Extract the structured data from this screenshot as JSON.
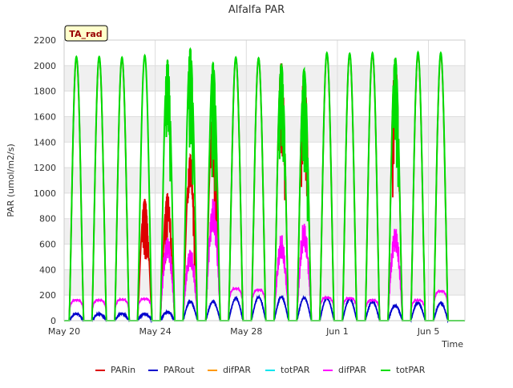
{
  "chart_data": {
    "type": "line",
    "title": "Alfalfa PAR",
    "xlabel": "Time",
    "ylabel": "PAR (umol/m2/s)",
    "station_badge": "TA_rad",
    "ylim": [
      0,
      2200
    ],
    "yticks": [
      0,
      200,
      400,
      600,
      800,
      1000,
      1200,
      1400,
      1600,
      1800,
      2000,
      2200
    ],
    "x_range_days": [
      0,
      17.6
    ],
    "xticks": [
      {
        "label": "May 20",
        "day": 0
      },
      {
        "label": "May 24",
        "day": 4
      },
      {
        "label": "May 28",
        "day": 8
      },
      {
        "label": "Jun 1",
        "day": 12
      },
      {
        "label": "Jun 5",
        "day": 16
      }
    ],
    "grid": true,
    "banded_background": true,
    "legend_position": "bottom",
    "colors": {
      "PARin": "#dd0000",
      "PARout": "#0000cc",
      "difPAR_a": "#ff9900",
      "totPAR_a": "#00e5ee",
      "difPAR_b": "#ff00ff",
      "totPAR_b": "#00dd00"
    },
    "legend": [
      {
        "label": "PARin",
        "color": "#dd0000"
      },
      {
        "label": "PARout",
        "color": "#0000cc"
      },
      {
        "label": "difPAR",
        "color": "#ff9900"
      },
      {
        "label": "totPAR",
        "color": "#00e5ee"
      },
      {
        "label": "difPAR",
        "color": "#ff00ff"
      },
      {
        "label": "totPAR",
        "color": "#00dd00"
      }
    ],
    "days": [
      {
        "day": 0,
        "tot": 2070,
        "parin": 2060,
        "parout": 55,
        "dif": 160,
        "note": "clear"
      },
      {
        "day": 1,
        "tot": 2070,
        "parin": 2060,
        "parout": 55,
        "dif": 160,
        "note": "clear"
      },
      {
        "day": 2,
        "tot": 2065,
        "parin": 2055,
        "parout": 55,
        "dif": 165,
        "note": "clear"
      },
      {
        "day": 3,
        "tot": 2080,
        "parin": 950,
        "parout": 55,
        "dif": 170,
        "note": "parin-dip"
      },
      {
        "day": 4,
        "tot": 2040,
        "parin": 1000,
        "parout": 70,
        "dif": 700,
        "note": "cloudy"
      },
      {
        "day": 5,
        "tot": 2130,
        "parin": 1300,
        "parout": 150,
        "dif": 600,
        "note": "partly"
      },
      {
        "day": 6,
        "tot": 2020,
        "parin": 1700,
        "parout": 150,
        "dif": 990,
        "note": "partly"
      },
      {
        "day": 7,
        "tot": 2065,
        "parin": 2060,
        "parout": 175,
        "dif": 250,
        "note": "clear"
      },
      {
        "day": 8,
        "tot": 2060,
        "parin": 2055,
        "parout": 185,
        "dif": 240,
        "note": "clear"
      },
      {
        "day": 9,
        "tot": 2020,
        "parin": 2020,
        "parout": 185,
        "dif": 680,
        "note": "cloudy"
      },
      {
        "day": 10,
        "tot": 1970,
        "parin": 1960,
        "parout": 180,
        "dif": 790,
        "note": "cloudy"
      },
      {
        "day": 11,
        "tot": 2100,
        "parin": 2090,
        "parout": 175,
        "dif": 180,
        "note": "clear"
      },
      {
        "day": 12,
        "tot": 2095,
        "parin": 2085,
        "parout": 170,
        "dif": 175,
        "note": "clear"
      },
      {
        "day": 13,
        "tot": 2100,
        "parin": 2090,
        "parout": 150,
        "dif": 160,
        "note": "clear"
      },
      {
        "day": 14,
        "tot": 2065,
        "parin": 2055,
        "parout": 120,
        "dif": 775,
        "note": "cloudy"
      },
      {
        "day": 15,
        "tot": 2105,
        "parin": 2090,
        "parout": 140,
        "dif": 160,
        "note": "clear"
      },
      {
        "day": 16,
        "tot": 2100,
        "parin": 2085,
        "parout": 140,
        "dif": 230,
        "note": "clear"
      }
    ]
  }
}
